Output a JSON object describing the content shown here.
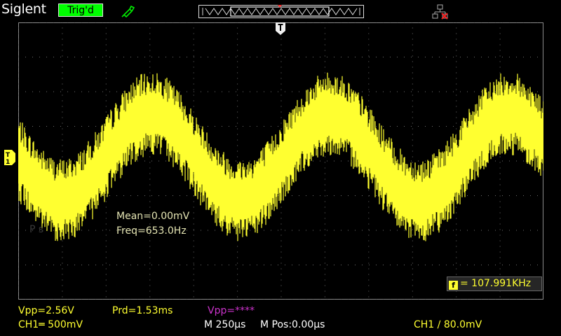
{
  "header": {
    "brand": "Siglent",
    "trigger_status": "Trig'd",
    "probe_icon": "probe-icon",
    "usb_icon": "usb-disconnected-icon",
    "memory_bar_icon": "memory-depth-bar"
  },
  "colors": {
    "background": "#000000",
    "grid_dots": "#6e6e6e",
    "channel1": "#ffff30",
    "channel2": "#cc33cc",
    "trig_status_bg": "#00ff00",
    "measurement_text": "#e6e6b4"
  },
  "display": {
    "ghost_text": "P          s",
    "measurements": {
      "mean": "Mean=0.00mV",
      "freq": "Freq=653.0Hz"
    },
    "counter": {
      "icon_label": "f",
      "value": "= 107.991KHz"
    }
  },
  "statusbar": {
    "vpp_ch1": "Vpp=2.56V",
    "prd": "Prd=1.53ms",
    "vpp_ch2": "Vpp=****",
    "ch1_scale": "CH1═ 500mV",
    "timebase": "M 250µs",
    "mpos": "M Pos:0.00µs",
    "trigger": "CH1 ∕ 80.0mV"
  }
}
